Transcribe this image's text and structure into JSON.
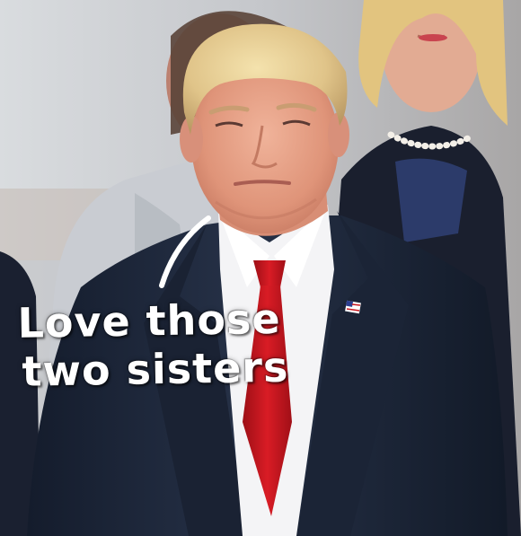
{
  "image": {
    "subject": "man in navy suit, white shirt and red tie with flag lapel pin, two women behind him"
  },
  "caption": {
    "line1": "Love those",
    "line2": "two sisters",
    "color": "#ffffff"
  },
  "colors": {
    "suit": "#1f2a3d",
    "tie": "#c8161d",
    "shirt": "#f4f4f6",
    "hair": "#e2c98f",
    "skin": "#e7a48b",
    "background": "#c9ccd1"
  }
}
